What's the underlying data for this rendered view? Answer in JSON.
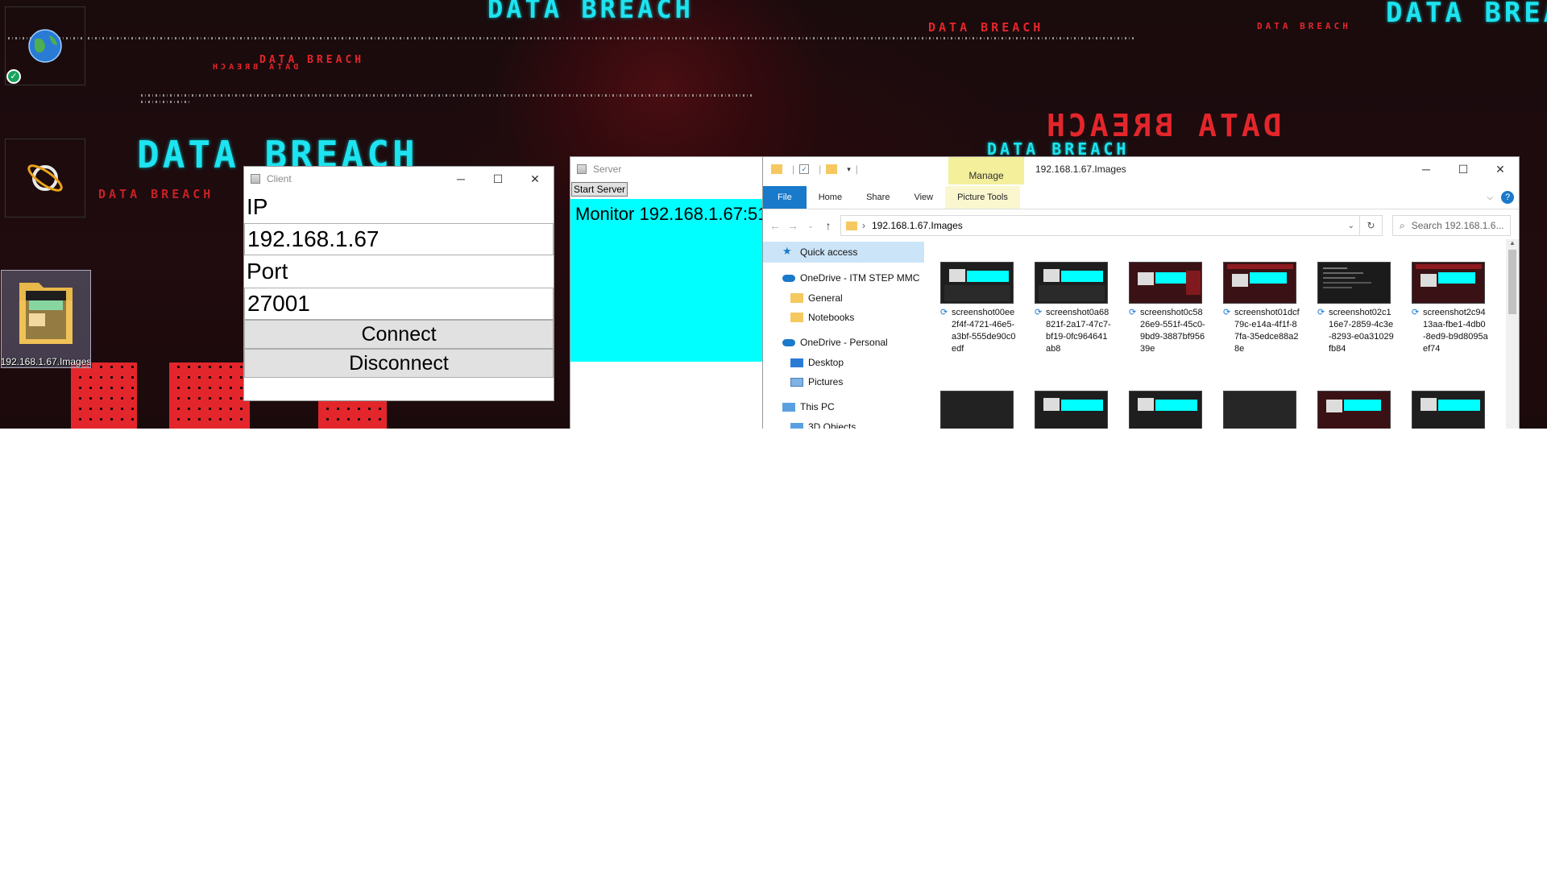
{
  "wallpaper": {
    "texts": [
      "DATA BREACH",
      "DATA BREACH",
      "DATA BREACH",
      "DATA BREACH",
      "DATA BREACH",
      "DATA BREACH",
      "DATA BREACH",
      "DATA BREACH",
      "DATA BREACH",
      "DATA BREACH"
    ]
  },
  "desktop_icons": [
    {
      "label": ""
    },
    {
      "label": ""
    },
    {
      "label": "192.168.1.67.Images"
    }
  ],
  "client": {
    "title": "Client",
    "ip_label": "IP",
    "ip_value": "192.168.1.67",
    "port_label": "Port",
    "port_value": "27001",
    "connect_label": "Connect",
    "disconnect_label": "Disconnect"
  },
  "server": {
    "title": "Server",
    "start_label": "Start Server",
    "monitor_text": "Monitor 192.168.1.67:51",
    "monitor_color": "#00ffff"
  },
  "explorer": {
    "title": "192.168.1.67.Images",
    "manage_tab": "Manage",
    "tabs": [
      "File",
      "Home",
      "Share",
      "View",
      "Picture Tools"
    ],
    "address_path": "192.168.1.67.Images",
    "search_placeholder": "Search 192.168.1.6...",
    "nav": [
      "Quick access",
      "OneDrive - ITM STEP MMC",
      "General",
      "Notebooks",
      "OneDrive - Personal",
      "Desktop",
      "Pictures",
      "This PC",
      "3D Objects"
    ],
    "files": [
      "screenshot00ee2f4f-4721-46e5-a3bf-555de90c0edf",
      "screenshot0a68821f-2a17-47c7-bf19-0fc964641ab8",
      "screenshot0c5826e9-551f-45c0-9bd9-3887bf95639e",
      "screenshot01dcf79c-e14a-4f1f-87fa-35edce88a28e",
      "screenshot02c116e7-2859-4c3e-8293-e0a31029fb84",
      "screenshot2c9413aa-fbe1-4db0-8ed9-b9d8095aef74"
    ],
    "accent": "#1979ca",
    "manage_color": "#f3ef9b"
  }
}
